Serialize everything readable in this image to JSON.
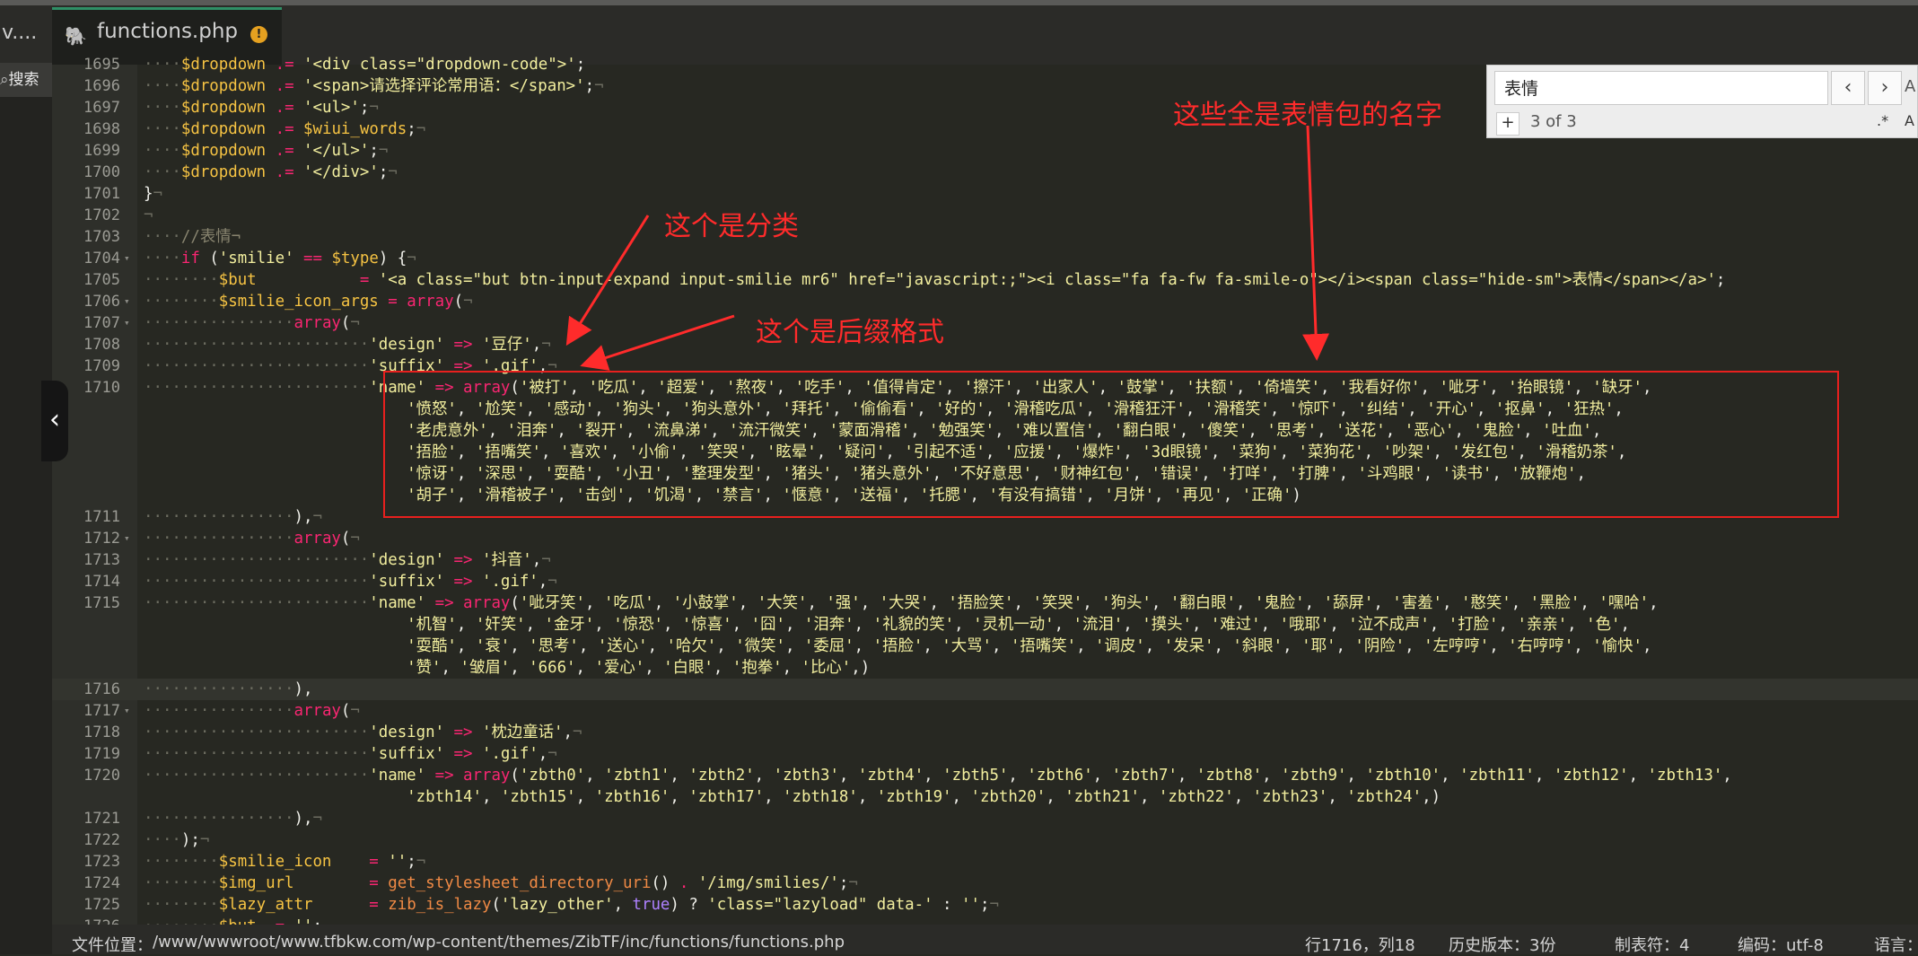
{
  "tabs": {
    "previous_label": "v....",
    "active_label": "functions.php",
    "warning_badge": "!"
  },
  "sidebar": {
    "search_label": "搜索"
  },
  "find": {
    "query": "表情",
    "prev": "‹",
    "next": "›",
    "option": "A",
    "add": "+",
    "count": "3 of 3",
    "regex": ".*",
    "case": "A"
  },
  "editor": {
    "lines": [
      {
        "n": "1695",
        "ind": "····",
        "code": "$dropdown .= '<div class=\"dropdown-code\">';"
      },
      {
        "n": "1696",
        "ind": "····",
        "code": "$dropdown .= '<span>请选择评论常用语：</span>';¬"
      },
      {
        "n": "1697",
        "ind": "····",
        "code": "$dropdown .= '<ul>';¬"
      },
      {
        "n": "1698",
        "ind": "····",
        "code": "$dropdown .= $wiui_words;¬"
      },
      {
        "n": "1699",
        "ind": "····",
        "code": "$dropdown .= '</ul>';¬"
      },
      {
        "n": "1700",
        "ind": "····",
        "code": "$dropdown .= '</div>';¬"
      },
      {
        "n": "1701",
        "ind": "",
        "code": "}¬"
      },
      {
        "n": "1702",
        "ind": "",
        "code": "¬"
      },
      {
        "n": "1703",
        "ind": "····",
        "code": "//表情¬"
      },
      {
        "n": "1704",
        "ind": "····",
        "code": "if ('smilie' == $type) {¬"
      },
      {
        "n": "1705",
        "ind": "········",
        "code": "$but           = '<a class=\"but btn-input-expand input-smilie mr6\" href=\"javascript:;\"><i class=\"fa fa-fw fa-smile-o\"></i><span class=\"hide-sm\">表情</span></a>';"
      },
      {
        "n": "1706",
        "ind": "········",
        "code": "$smilie_icon_args = array(¬"
      },
      {
        "n": "1707",
        "ind": "················",
        "code": "array(¬"
      },
      {
        "n": "1708",
        "ind": "························",
        "code": "'design' => '豆仔',¬"
      },
      {
        "n": "1709",
        "ind": "························",
        "code": "'suffix' => '.gif',¬"
      },
      {
        "n": "1710",
        "ind": "························",
        "code": "'name' => array('被打', '吃瓜', '超爱', '熬夜', '吃手', '值得肯定', '擦汗', '出家人', '鼓掌', '扶额', '倚墙笑', '我看好你', '呲牙', '抬眼镜', '缺牙',"
      },
      {
        "n": "",
        "ind": "                            ",
        "code": "'愤怒', '尬笑', '感动', '狗头', '狗头意外', '拜托', '偷偷看', '好的', '滑稽吃瓜', '滑稽狂汗', '滑稽笑', '惊吓', '纠结', '开心', '抠鼻', '狂热',"
      },
      {
        "n": "",
        "ind": "                            ",
        "code": "'老虎意外', '泪奔', '裂开', '流鼻涕', '流汗微笑', '蒙面滑稽', '勉强笑', '难以置信', '翻白眼', '傻笑', '思考', '送花', '恶心', '鬼脸', '吐血',"
      },
      {
        "n": "",
        "ind": "                            ",
        "code": "'捂脸', '捂嘴笑', '喜欢', '小偷', '笑哭', '眩晕', '疑问', '引起不适', '应援', '爆炸', '3d眼镜', '菜狗', '菜狗花', '吵架', '发红包', '滑稽奶茶',"
      },
      {
        "n": "",
        "ind": "                            ",
        "code": "'惊讶', '深思', '耍酷', '小丑', '整理发型', '猪头', '猪头意外', '不好意思', '财神红包', '错误', '打咩', '打脾', '斗鸡眼', '读书', '放鞭炮',"
      },
      {
        "n": "",
        "ind": "                            ",
        "code": "'胡子', '滑稽被子', '击剑', '饥渴', '禁言', '惬意', '送福', '托腮', '有没有搞错', '月饼', '再见', '正确')"
      },
      {
        "n": "1711",
        "ind": "················",
        "code": "),¬"
      },
      {
        "n": "1712",
        "ind": "················",
        "code": "array(¬"
      },
      {
        "n": "1713",
        "ind": "························",
        "code": "'design' => '抖音',¬"
      },
      {
        "n": "1714",
        "ind": "························",
        "code": "'suffix' => '.gif',¬"
      },
      {
        "n": "1715",
        "ind": "························",
        "code": "'name' => array('呲牙笑', '吃瓜', '小鼓掌', '大笑', '强', '大哭', '捂脸笑', '笑哭', '狗头', '翻白眼', '鬼脸', '舔屏', '害羞', '憨笑', '黑脸', '嘿哈',"
      },
      {
        "n": "",
        "ind": "                            ",
        "code": "'机智', '奸笑', '金牙', '惊恐', '惊喜', '囧', '泪奔', '礼貌的笑', '灵机一动', '流泪', '摸头', '难过', '哦耶', '泣不成声', '打脸', '亲亲', '色',"
      },
      {
        "n": "",
        "ind": "                            ",
        "code": "'耍酷', '衰', '思考', '送心', '哈欠', '微笑', '委屈', '捂脸', '大骂', '捂嘴笑', '调皮', '发呆', '斜眼', '耶', '阴险', '左哼哼', '右哼哼', '愉快',"
      },
      {
        "n": "",
        "ind": "                            ",
        "code": "'赞', '皱眉', '666', '爱心', '白眼', '抱拳', '比心',)"
      },
      {
        "n": "1716",
        "ind": "················",
        "code": "),",
        "current": true
      },
      {
        "n": "1717",
        "ind": "················",
        "code": "array(¬"
      },
      {
        "n": "1718",
        "ind": "························",
        "code": "'design' => '枕边童话',¬"
      },
      {
        "n": "1719",
        "ind": "························",
        "code": "'suffix' => '.gif',¬"
      },
      {
        "n": "1720",
        "ind": "························",
        "code": "'name' => array('zbth0', 'zbth1', 'zbth2', 'zbth3', 'zbth4', 'zbth5', 'zbth6', 'zbth7', 'zbth8', 'zbth9', 'zbth10', 'zbth11', 'zbth12', 'zbth13',"
      },
      {
        "n": "",
        "ind": "                            ",
        "code": "'zbth14', 'zbth15', 'zbth16', 'zbth17', 'zbth18', 'zbth19', 'zbth20', 'zbth21', 'zbth22', 'zbth23', 'zbth24',)"
      },
      {
        "n": "1721",
        "ind": "················",
        "code": "),¬"
      },
      {
        "n": "1722",
        "ind": "····",
        "code": ");¬"
      },
      {
        "n": "1723",
        "ind": "········",
        "code": "$smilie_icon    = '';¬"
      },
      {
        "n": "1724",
        "ind": "········",
        "code": "$img_url        = get_stylesheet_directory_uri() . '/img/smilies/';¬"
      },
      {
        "n": "1725",
        "ind": "········",
        "code": "$lazy_attr      = zib_is_lazy('lazy_other', true) ? 'class=\"lazyload\" data-' : '';¬"
      },
      {
        "n": "1726",
        "ind": "········",
        "code": "$but .= '';"
      }
    ]
  },
  "annotations": {
    "category": "这个是分类",
    "suffix": "这个是后缀格式",
    "names": "这些全是表情包的名字"
  },
  "status": {
    "path_label": "文件位置：",
    "path": "/www/wwwroot/www.tfbkw.com/wp-content/themes/ZibTF/inc/functions/functions.php",
    "position": "行1716，列18",
    "history": "历史版本：3份",
    "tab": "制表符：4",
    "encoding": "编码：utf-8",
    "language": "语言："
  },
  "colors": {
    "editor_bg": "#272822",
    "gutter_bg": "#2e2f2a",
    "keyword": "#f92672",
    "variable": "#f6c343",
    "string": "#f2ee9e",
    "function": "#f08a45",
    "annotation": "#ff2b2b",
    "tab_accent": "#2f8f66"
  }
}
